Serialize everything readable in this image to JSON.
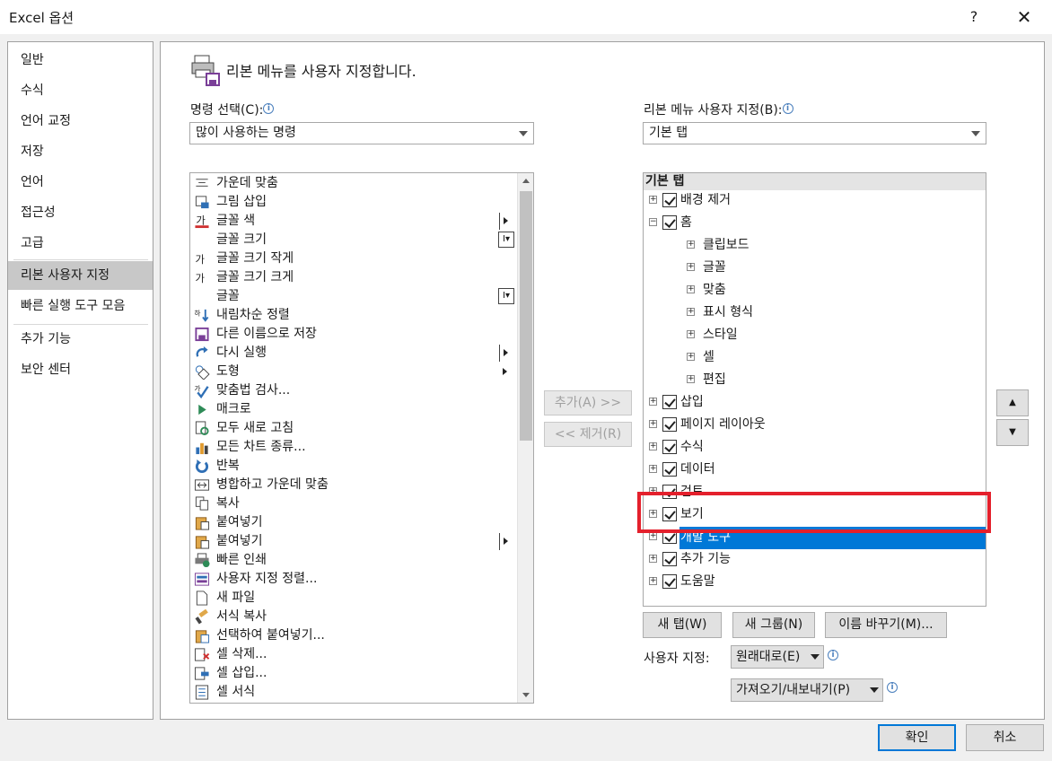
{
  "window": {
    "title": "Excel 옵션",
    "help": "?",
    "close": "✕"
  },
  "nav": {
    "items": [
      {
        "label": "일반"
      },
      {
        "label": "수식"
      },
      {
        "label": "언어 교정"
      },
      {
        "label": "저장"
      },
      {
        "label": "언어"
      },
      {
        "label": "접근성"
      },
      {
        "label": "고급"
      },
      {
        "label": "리본 사용자 지정"
      },
      {
        "label": "빠른 실행 도구 모음"
      },
      {
        "label": "추가 기능"
      },
      {
        "label": "보안 센터"
      }
    ],
    "selected": "리본 사용자 지정"
  },
  "header": {
    "title": "리본 메뉴를 사용자 지정합니다."
  },
  "left": {
    "label": "명령 선택(C):",
    "combo_value": "많이 사용하는 명령",
    "commands": [
      {
        "label": "가운데 맞춤",
        "icon": "align-center-icon"
      },
      {
        "label": "그림 삽입",
        "icon": "insert-picture-icon"
      },
      {
        "label": "글꼴 색",
        "icon": "font-color-icon",
        "submenu": true
      },
      {
        "label": "글꼴 크기",
        "icon": "",
        "dropdown": true
      },
      {
        "label": "글꼴 크기 작게",
        "icon": "font-size-decrease-icon"
      },
      {
        "label": "글꼴 크기 크게",
        "icon": "font-size-increase-icon"
      },
      {
        "label": "글꼴",
        "icon": "",
        "dropdown": true
      },
      {
        "label": "내림차순 정렬",
        "icon": "sort-descending-icon"
      },
      {
        "label": "다른 이름으로 저장",
        "icon": "save-as-icon"
      },
      {
        "label": "다시 실행",
        "icon": "redo-icon",
        "submenu": true
      },
      {
        "label": "도형",
        "icon": "shapes-icon",
        "submenu_plain": true
      },
      {
        "label": "맞춤법 검사...",
        "icon": "spelling-icon"
      },
      {
        "label": "매크로",
        "icon": "macro-icon"
      },
      {
        "label": "모두 새로 고침",
        "icon": "refresh-all-icon"
      },
      {
        "label": "모든 차트 종류...",
        "icon": "chart-types-icon"
      },
      {
        "label": "반복",
        "icon": "repeat-icon"
      },
      {
        "label": "병합하고 가운데 맞춤",
        "icon": "merge-center-icon"
      },
      {
        "label": "복사",
        "icon": "copy-icon"
      },
      {
        "label": "붙여넣기",
        "icon": "paste-icon"
      },
      {
        "label": "붙여넣기",
        "icon": "paste-icon",
        "submenu": true
      },
      {
        "label": "빠른 인쇄",
        "icon": "quick-print-icon"
      },
      {
        "label": "사용자 지정 정렬...",
        "icon": "custom-sort-icon"
      },
      {
        "label": "새 파일",
        "icon": "new-file-icon"
      },
      {
        "label": "서식 복사",
        "icon": "format-painter-icon"
      },
      {
        "label": "선택하여 붙여넣기...",
        "icon": "paste-special-icon"
      },
      {
        "label": "셀 삭제...",
        "icon": "delete-cells-icon"
      },
      {
        "label": "셀 삽입...",
        "icon": "insert-cells-icon"
      },
      {
        "label": "셀 서식",
        "icon": "format-cells-icon"
      }
    ]
  },
  "middle": {
    "add": "추가(A) >>",
    "remove": "<< 제거(R)"
  },
  "right": {
    "label": "리본 메뉴 사용자 지정(B):",
    "combo_value": "기본 탭",
    "tree_header": "기본 탭",
    "tree": [
      {
        "label": "배경 제거",
        "level": 0,
        "expander": "+",
        "checked": true
      },
      {
        "label": "홈",
        "level": 0,
        "expander": "−",
        "checked": true
      },
      {
        "label": "클립보드",
        "level": 1,
        "expander": "+"
      },
      {
        "label": "글꼴",
        "level": 1,
        "expander": "+"
      },
      {
        "label": "맞춤",
        "level": 1,
        "expander": "+"
      },
      {
        "label": "표시 형식",
        "level": 1,
        "expander": "+"
      },
      {
        "label": "스타일",
        "level": 1,
        "expander": "+"
      },
      {
        "label": "셀",
        "level": 1,
        "expander": "+"
      },
      {
        "label": "편집",
        "level": 1,
        "expander": "+"
      },
      {
        "label": "삽입",
        "level": 0,
        "expander": "+",
        "checked": true
      },
      {
        "label": "페이지 레이아웃",
        "level": 0,
        "expander": "+",
        "checked": true
      },
      {
        "label": "수식",
        "level": 0,
        "expander": "+",
        "checked": true
      },
      {
        "label": "데이터",
        "level": 0,
        "expander": "+",
        "checked": true
      },
      {
        "label": "검토",
        "level": 0,
        "expander": "+",
        "checked": true
      },
      {
        "label": "보기",
        "level": 0,
        "expander": "+",
        "checked": true
      },
      {
        "label": "개발 도구",
        "level": 0,
        "expander": "+",
        "checked": true,
        "selected": true
      },
      {
        "label": "추가 기능",
        "level": 0,
        "expander": "+",
        "checked": true
      },
      {
        "label": "도움말",
        "level": 0,
        "expander": "+",
        "checked": true
      }
    ],
    "move_up": "▲",
    "move_down": "▼",
    "new_tab": "새 탭(W)",
    "new_group": "새 그룹(N)",
    "rename": "이름 바꾸기(M)...",
    "customize_label": "사용자 지정:",
    "reset": "원래대로(E)",
    "import_export": "가져오기/내보내기(P)"
  },
  "footer": {
    "ok": "확인",
    "cancel": "취소"
  },
  "colors": {
    "selection": "#0078d7",
    "highlight_box": "#e4202c"
  }
}
